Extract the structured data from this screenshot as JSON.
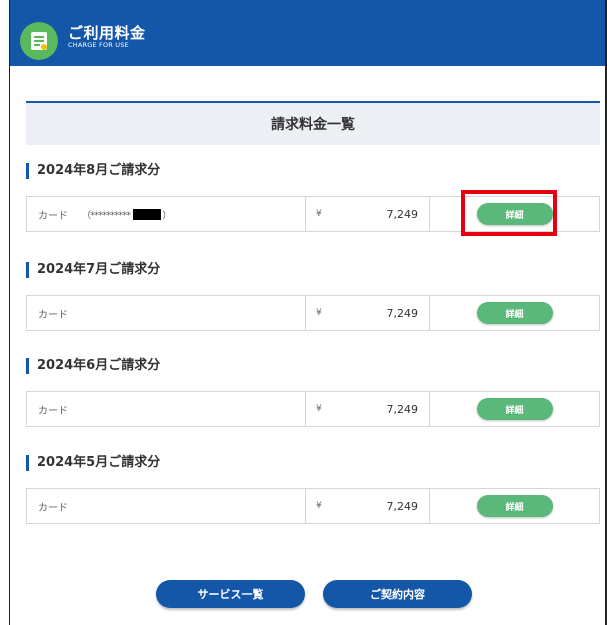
{
  "header": {
    "title": "ご利用料金",
    "subtitle": "CHARGE FOR USE"
  },
  "list_title": "請求料金一覧",
  "billing_sections": [
    {
      "title": "2024年8月ご請求分",
      "method": "カード",
      "masked_card": "（**********",
      "masked_card_end": "）",
      "yen": "¥",
      "amount": "7,249",
      "button": "詳細"
    },
    {
      "title": "2024年7月ご請求分",
      "method": "カード",
      "yen": "¥",
      "amount": "7,249",
      "button": "詳細"
    },
    {
      "title": "2024年6月ご請求分",
      "method": "カード",
      "yen": "¥",
      "amount": "7,249",
      "button": "詳細"
    },
    {
      "title": "2024年5月ご請求分",
      "method": "カード",
      "yen": "¥",
      "amount": "7,249",
      "button": "詳細"
    }
  ],
  "footer": {
    "service_list_button": "サービス一覧",
    "contract_button": "ご契約内容"
  },
  "colors": {
    "header_bg": "#1457a8",
    "logo_green": "#5cb85c",
    "detail_button": "#59b87a",
    "highlight_border": "#e60012"
  },
  "icons": {
    "logo": "document-icon"
  }
}
